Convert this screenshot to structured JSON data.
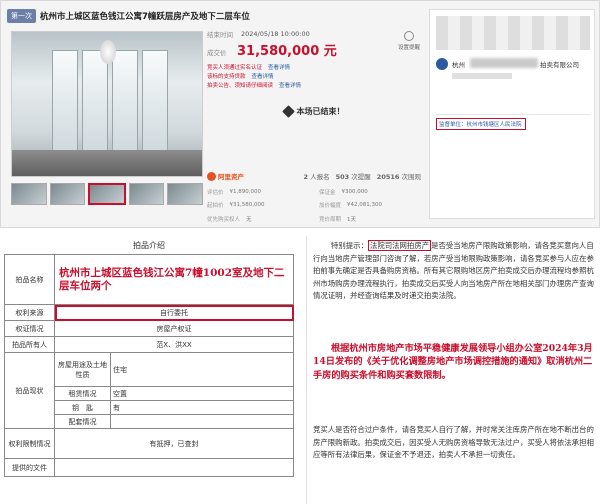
{
  "top": {
    "tag": "第一次",
    "title": "杭州市上城区蓝色钱江公寓7幢跃层房产及地下二层车位",
    "end_time_label": "结束时间",
    "end_time": "2024/05/18 10:00:00",
    "price_label": "成交价",
    "price": "31,580,000 元",
    "notices": [
      {
        "text": "竞买人须通过实名认证",
        "link": "查看详情"
      },
      {
        "text": "该标的支持贷款",
        "link": "查看详情"
      },
      {
        "text": "拍卖公告、须知请仔细阅读",
        "link": "查看详情"
      }
    ],
    "ended_text": "本场已结束！",
    "subscribe_label": "设置提醒",
    "ali_label": "阿里资产",
    "stats": [
      {
        "num": "2",
        "label": "人报名"
      },
      {
        "num": "503",
        "label": "次提醒"
      },
      {
        "num": "20516",
        "label": "次围观"
      }
    ],
    "bottom_info": [
      {
        "label": "评估价",
        "value": "¥1,890,000"
      },
      {
        "label": "保证金",
        "value": "¥300,000"
      },
      {
        "label": "起拍价",
        "value": "¥31,580,000"
      },
      {
        "label": "加价幅度",
        "value": "¥42,081,300"
      },
      {
        "label": "优先购买权人",
        "value": "无"
      },
      {
        "label": "竞价周期",
        "value": "1天"
      }
    ],
    "org_prefix": "杭州",
    "org_suffix": "拍卖有限公司",
    "court": "监督单位：杭州市钱塘区人民法院"
  },
  "intro": {
    "title": "拍品介绍",
    "rows": {
      "name_label": "拍品名称",
      "name_value": "杭州市上城区蓝色钱江公寓7幢1002室及地下二层车位两个",
      "rights_label": "权利来源",
      "rights_value": "自行委托",
      "cert_label": "权证情况",
      "cert_value": "房屋产权证",
      "owner_label": "拍品所有人",
      "owner_value": "范X、洪XX",
      "status_label": "拍品现状",
      "use_label": "房屋用途及土地性质",
      "use_value": "住宅",
      "rent_label": "租赁情况",
      "rent_value": "空置",
      "key_label": "钥　匙",
      "key_value": "有",
      "facility_label": "配套情况",
      "facility_value": "",
      "restrict_label": "权利限制情况",
      "restrict_value": "有抵押，已查封",
      "doc_label": "提供的文件",
      "doc_value": ""
    }
  },
  "special": {
    "prefix": "特别提示：",
    "highlight": "法院司法网拍房产",
    "para1": "是否受当地房产限购政策影响，请各竞买意向人自行向当地房产管理部门咨询了解，若房产受当地限购政策影响，请各竞买参与人应在参拍前事先确定是否具备购房资格。所有其它限购地区房产拍卖成交后办理流程均参照杭州市场购房办理流程执行，拍卖成交后买受人向当地房产所在地相关部门办理房产查询情况证明，并经查询结果及时递交拍卖法院。",
    "red_para": "根据杭州市房地产市场平稳健康发展领导小组办公室2024年3月14日发布的《关于优化调整房地产市场调控措施的通知》取消杭州二手房的购买条件和购买套数限制。",
    "tail": "竞买人是否符合过户条件，请各竞买人自行了解，并时常关注库房产所在地不断出台的房产限购新政。拍卖成交后，因买受人无购房资格导致无法过户，买受人将依法承担相应等所有法律后果，保证金不予退还，拍卖人不承担一切责任。"
  }
}
